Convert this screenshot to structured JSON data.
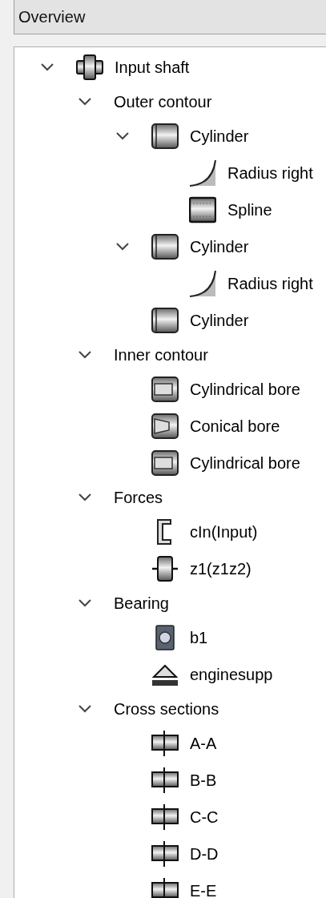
{
  "header": {
    "title": "Overview"
  },
  "tree": [
    {
      "label": "Input shaft",
      "kind": "shaft",
      "expanded": true,
      "children": [
        {
          "label": "Outer contour",
          "kind": "group",
          "expanded": true,
          "children": [
            {
              "label": "Cylinder",
              "kind": "cylinder",
              "expanded": true,
              "children": [
                {
                  "label": "Radius right",
                  "kind": "radius"
                },
                {
                  "label": "Spline",
                  "kind": "spline"
                }
              ]
            },
            {
              "label": "Cylinder",
              "kind": "cylinder",
              "expanded": true,
              "children": [
                {
                  "label": "Radius right",
                  "kind": "radius"
                }
              ]
            },
            {
              "label": "Cylinder",
              "kind": "cylinder"
            }
          ]
        },
        {
          "label": "Inner contour",
          "kind": "group",
          "expanded": true,
          "children": [
            {
              "label": "Cylindrical bore",
              "kind": "bore"
            },
            {
              "label": "Conical bore",
              "kind": "conical-bore"
            },
            {
              "label": "Cylindrical bore",
              "kind": "bore"
            }
          ]
        },
        {
          "label": "Forces",
          "kind": "group",
          "expanded": true,
          "children": [
            {
              "label": "cIn(Input)",
              "kind": "coupling"
            },
            {
              "label": "z1(z1z2)",
              "kind": "gear"
            }
          ]
        },
        {
          "label": "Bearing",
          "kind": "group",
          "expanded": true,
          "children": [
            {
              "label": "b1",
              "kind": "bearing"
            },
            {
              "label": "enginesupp",
              "kind": "support"
            }
          ]
        },
        {
          "label": "Cross sections",
          "kind": "group",
          "expanded": true,
          "children": [
            {
              "label": "A-A",
              "kind": "section"
            },
            {
              "label": "B-B",
              "kind": "section"
            },
            {
              "label": "C-C",
              "kind": "section"
            },
            {
              "label": "D-D",
              "kind": "section"
            },
            {
              "label": "E-E",
              "kind": "section"
            }
          ]
        }
      ]
    }
  ]
}
